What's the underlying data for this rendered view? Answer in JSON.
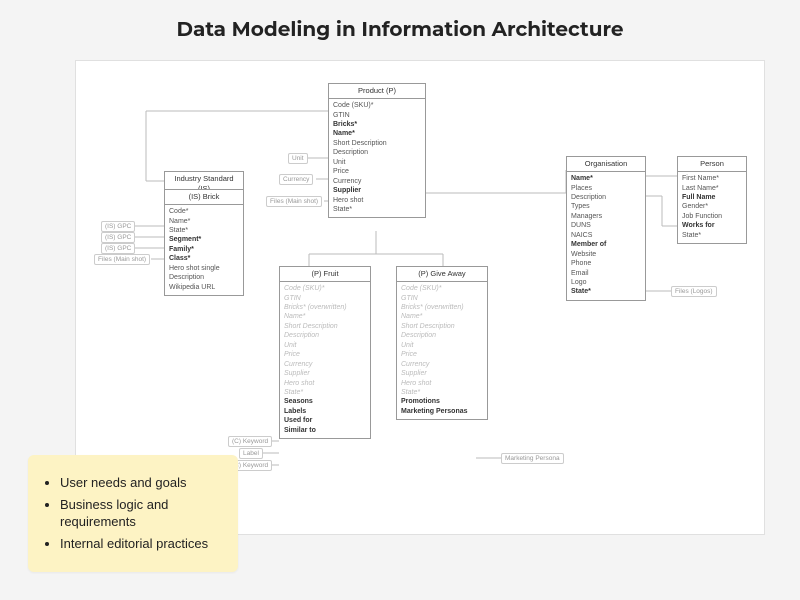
{
  "title": "Data Modeling in Information Architecture",
  "note": {
    "items": [
      "User needs and goals",
      "Business logic and requirements",
      "Internal editorial practices"
    ]
  },
  "entities": {
    "industry_standard": {
      "header": "Industry Standard (IS)"
    },
    "is_brick": {
      "header": "(IS) Brick",
      "attrs": [
        "Code*",
        "Name*",
        "State*",
        "Segment*",
        "Family*",
        "Class*",
        "Hero shot single",
        "Description",
        "Wikipedia URL"
      ]
    },
    "product": {
      "header": "Product (P)",
      "attrs": [
        "Code (SKU)*",
        "GTIN",
        "Bricks*",
        "Name*",
        "Short Description",
        "Description",
        "Unit",
        "Price",
        "Currency",
        "Supplier",
        "Hero shot",
        "State*"
      ]
    },
    "p_fruit": {
      "header": "(P) Fruit",
      "attrs_faded": [
        "Code (SKU)*",
        "GTIN",
        "Bricks* (overwritten)",
        "Name*",
        "Short Description",
        "Description",
        "Unit",
        "Price",
        "Currency",
        "Supplier",
        "Hero shot",
        "State*"
      ],
      "attrs_extra": [
        "Seasons",
        "Labels",
        "Used for",
        "Similar to"
      ]
    },
    "p_giveaway": {
      "header": "(P) Give Away",
      "attrs_faded": [
        "Code (SKU)*",
        "GTIN",
        "Bricks* (overwritten)",
        "Name*",
        "Short Description",
        "Description",
        "Unit",
        "Price",
        "Currency",
        "Supplier",
        "Hero shot",
        "State*"
      ],
      "attrs_extra": [
        "Promotions",
        "Marketing Personas"
      ]
    },
    "organisation": {
      "header": "Organisation",
      "attrs": [
        "Name*",
        "Places",
        "Description",
        "Types",
        "Managers",
        "DUNS",
        "NAICS",
        "Member of",
        "Website",
        "Phone",
        "Email",
        "Logo",
        "State*"
      ]
    },
    "person": {
      "header": "Person",
      "attrs": [
        "First Name*",
        "Last Name*",
        "Full Name",
        "Gender*",
        "Job Function",
        "Works for",
        "State*"
      ]
    }
  },
  "tags": {
    "is_gpc1": "(IS) GPC",
    "is_gpc2": "(IS) GPC",
    "is_gpc3": "(IS) GPC",
    "files_main_shot1": "Files (Main shot)",
    "unit": "Unit",
    "currency": "Currency",
    "files_main_shot2": "Files (Main shot)",
    "c_keyword1": "(C) Keyword",
    "label": "Label",
    "c_keyword2": "(C) Keyword",
    "marketing_persona": "Marketing Persona",
    "files_logos": "Files (Logos)"
  }
}
